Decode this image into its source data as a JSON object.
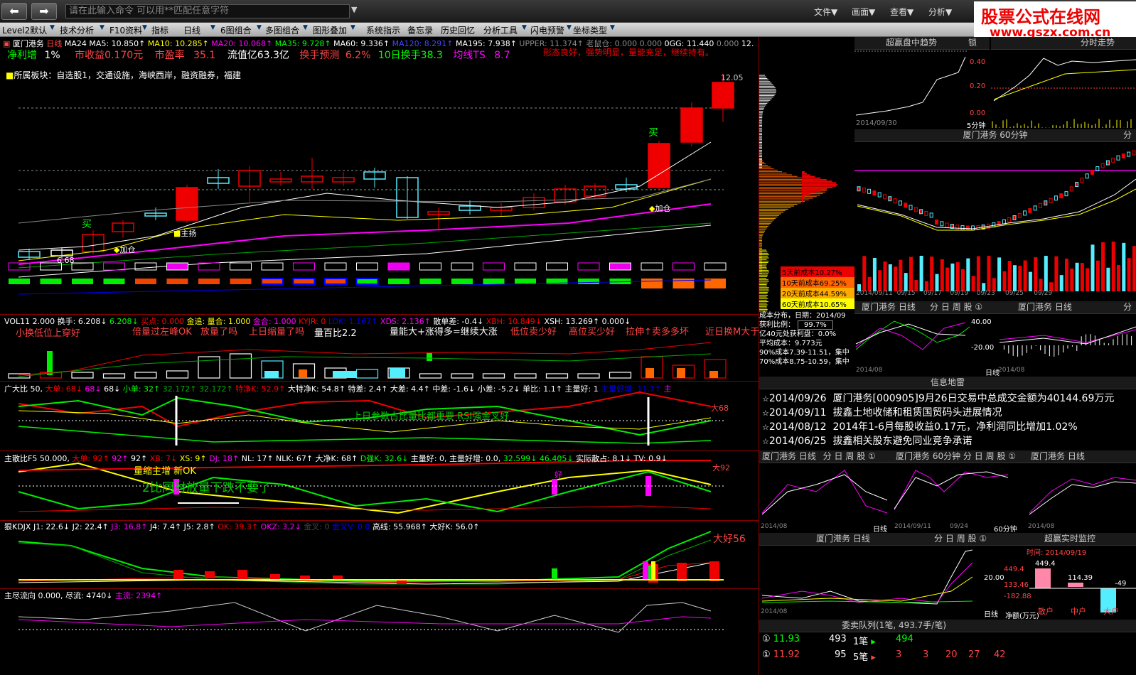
{
  "toolbar_top": {
    "cmd_placeholder": "请在此输入命令  可以用**匹配任意字符",
    "menus": [
      "文件▼",
      "画面▼",
      "查看▼",
      "分析▼"
    ]
  },
  "logo": {
    "line1": "股票公式在线网",
    "line2": "www.gszx.com.cn"
  },
  "toolbar": [
    "Level2默认",
    "技术分析",
    "F10资料",
    "指标",
    "日线",
    "6图组合",
    "多图组合",
    "图形叠加",
    "系统指示",
    "备忘录",
    "历史回忆",
    "分析工具",
    "闪电预警",
    "坐标类型"
  ],
  "main": {
    "ma_line": {
      "name": "厦门港务",
      "period": "日线",
      "items": [
        "MA24",
        "MA5: 10.850↑",
        "MA10: 10.285↑",
        "MA20: 10.068↑",
        "MA35: 9.728↑",
        "MA60: 9.336↑",
        "MA120: 8.291↑",
        "MA195: 7.938↑",
        "UPPER: 11.374↑",
        "老鼠仓: 0.000",
        "0.000",
        "0GG: 11.440",
        "0.000",
        "12."
      ]
    },
    "info": {
      "jlz": "净利增",
      "jlz_v": "1%",
      "mgsy": "市收益0.170元",
      "syl": "市盈率",
      "syl_v": "35.1",
      "ltsz": "流值亿63.3亿",
      "hsyc": "换手预测",
      "hsyc_v": "6.2%",
      "hs10": "10日换手38.3",
      "jxts": "均线TS",
      "jxts_v": "8.7",
      "note": "形态良好，强势明显，量能充足，继续持有。"
    },
    "sector": "所属板块：自选股1，交通设施，海峡西岸，融资融券，福建",
    "price_hi": "12.05",
    "price_lo": "6.68",
    "labels": {
      "buy1": "买",
      "buy2": "买",
      "jc1": "加仓",
      "jc2": "加仓",
      "zhu": "主扬"
    }
  },
  "vol": {
    "head": [
      "VOL11",
      "2.000",
      "换手: 6.208↓",
      "6.208↓",
      "买点: 0.000",
      "金追: 量合: 1.000",
      "金合: 1.000",
      "KYJR: 0",
      "LOK: 1.167↑",
      "XDS: 2.136↑",
      "散单差: -0.4↓",
      "XBH: 10.849↓",
      "XSH: 13.269↑",
      "0.000↓"
    ],
    "notes": [
      "小换低位上穿好",
      "倍量过左峰OK",
      "放量了吗",
      "上日缩量了吗",
      "量百比2.2",
      "量能大+涨得多=继续大涨",
      "低位卖少好",
      "高位买少好",
      "拉伸↑卖多多坏",
      "近日换M大于"
    ]
  },
  "dhb": {
    "head": [
      "广大比",
      "50,",
      "大单: 68↓",
      "68↓",
      "68↓",
      "小单: 32↑",
      "32.172↑",
      "32.172↑",
      "特净K: 52.9↑",
      "大特净K: 54.8↑",
      "特差: 2.4↑",
      "大差: 4.4↑",
      "中差: -1.6↓",
      "小差: -5.2↓",
      "单比: 1.1↑",
      "主量好: 1",
      "主量好增: 11.7↑",
      "主"
    ],
    "note": "上日参数占比量比都重要 RSI强金叉好",
    "r": "大68"
  },
  "zsb": {
    "head": [
      "主散比F5",
      "50.000,",
      "大单: 92↑",
      "92↑",
      "92↑",
      "XB: 7↓",
      "XS: 9↑",
      "DJ: 18↑",
      "NL: 17↑",
      "NLK: 67↑",
      "大净K: 68↑",
      "D强K: 32.6↓",
      "主量好: 0,",
      "主量好增: 0.0,",
      "32.599↓",
      "46.405↓",
      "实际散占: 8.1↓",
      "TV: 0.9↓"
    ],
    "n1": "量缩主增 新OK",
    "n2": "2比同时放量下跌不要了",
    "r": "大92",
    "hao": "好"
  },
  "kdj": {
    "head": [
      "狠KDJX",
      "J1: 22.6↓",
      "J2: 22.4↑",
      "J3: 16.8↑",
      "J4: 7.4↑",
      "J5: 2.8↑",
      "OK: 39.3↑",
      "OKZ: 3.2↓",
      "金叉: 0",
      "金叉V: 0.0",
      "高线: 55.968↑",
      "大好K: 56.0↑"
    ],
    "r": "大好56"
  },
  "zjl": {
    "head": [
      "主尽流向",
      "0.000,",
      "尽流: 4740↓",
      "主流: 2394↑"
    ]
  },
  "right": {
    "chip": [
      {
        "t": "5天前成本10.27%",
        "c": "#e00"
      },
      {
        "t": "10天前成本69.25%",
        "c": "#f60"
      },
      {
        "t": "20天前成本44.59%",
        "c": "#fa0"
      },
      {
        "t": "60天前成本10.65%",
        "c": "#ff0"
      }
    ],
    "chip_info": [
      "成本分布，日期：2014/09",
      "获利比例：",
      "99.7%",
      "亿40元处获利盘：0.0%",
      "平均成本：9.773元",
      "90%成本7.39-11.51，集中",
      "70%成本8.75-10.59，集中"
    ],
    "p1": {
      "title": "超赢盘中趋势",
      "lock": "锁"
    },
    "p2": {
      "title": "分时走势"
    },
    "p1_y": [
      "0.40",
      "0.20",
      "0.00"
    ],
    "p1_x": "2014/09/30",
    "p1_t": "5分钟",
    "p3": {
      "title": "厦门港务 60分钟",
      "r": "分"
    },
    "p3_x": [
      "2014/09/11",
      "09/15",
      "09/17",
      "09/19",
      "09/23",
      "09/25",
      "09/29"
    ],
    "tabs": [
      "分",
      "日",
      "周",
      "股",
      "①"
    ],
    "p4": {
      "title": "厦门港务  日线"
    },
    "p5": {
      "title": "厦门港务  日线"
    },
    "p4_y": [
      "40.00",
      "-20.00"
    ],
    "p4_x": "2014/08",
    "p5_x": "2014/08",
    "dx": "日线",
    "info_title": "信息地雷",
    "news": [
      {
        "d": "2014/09/26",
        "t": "厦门港务[000905]9月26日交易中总成交金额为40144.69万元"
      },
      {
        "d": "2014/09/11",
        "t": "拔鑫土地收储和租赁国贸码头进展情况"
      },
      {
        "d": "2014/08/12",
        "t": "2014年1-6月每股收益0.17元，净利润同比增加1.02%"
      },
      {
        "d": "2014/06/25",
        "t": "拔鑫相关股东避免同业竞争承诺"
      }
    ],
    "p6": {
      "title": "厦门港务 日线"
    },
    "p7": {
      "title": "厦门港务 60分钟"
    },
    "p8": {
      "title": "厦门港务 日线"
    },
    "p6_x": "2014/08",
    "p7_x": "2014/09/11",
    "p7_x2": "09/24",
    "p8_x": "2014/08",
    "p6_b": "日线",
    "p7_b": "60分钟",
    "p9": {
      "title": "厦门港务 日线"
    },
    "p10": {
      "title": "超赢实时监控"
    },
    "p10_time": "时间: 2014/09/19",
    "p10_vals": [
      "449.4",
      "449.4",
      "114.39",
      "133.46",
      "-182.88",
      "-49"
    ],
    "p10_x": [
      "散户",
      "中户",
      "大户"
    ],
    "p9_b": [
      "日线",
      "净额(万元)"
    ],
    "p9_y": "20.00",
    "p9_x": "2014/08",
    "queue_title": "委卖队列(1笔, 493.7手/笔)",
    "q1": {
      "code": "11.93",
      "a": "493",
      "b": "1笔",
      "c": "494"
    },
    "q2": {
      "code": "11.92",
      "a": "95",
      "b": "5笔",
      "v": [
        "3",
        "3",
        "20",
        "27",
        "42"
      ]
    }
  }
}
